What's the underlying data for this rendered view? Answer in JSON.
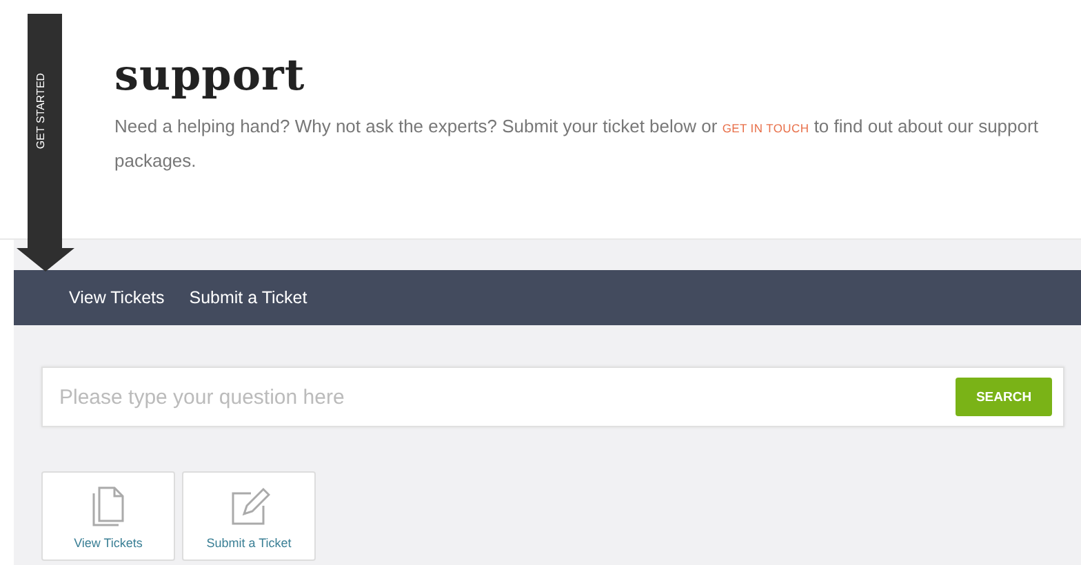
{
  "ribbon": {
    "label": "GET STARTED"
  },
  "header": {
    "title": "support",
    "intro_before": "Need a helping hand? Why not ask the experts? Submit your ticket below or",
    "intro_link": "GET IN TOUCH",
    "intro_after": "to find out about our support packages."
  },
  "nav": {
    "items": [
      {
        "label": "View Tickets"
      },
      {
        "label": "Submit a Ticket"
      }
    ]
  },
  "search": {
    "placeholder": "Please type your question here",
    "button": "SEARCH"
  },
  "cards": [
    {
      "kind": "documents",
      "label": "View Tickets"
    },
    {
      "kind": "edit",
      "label": "Submit a Ticket"
    }
  ]
}
